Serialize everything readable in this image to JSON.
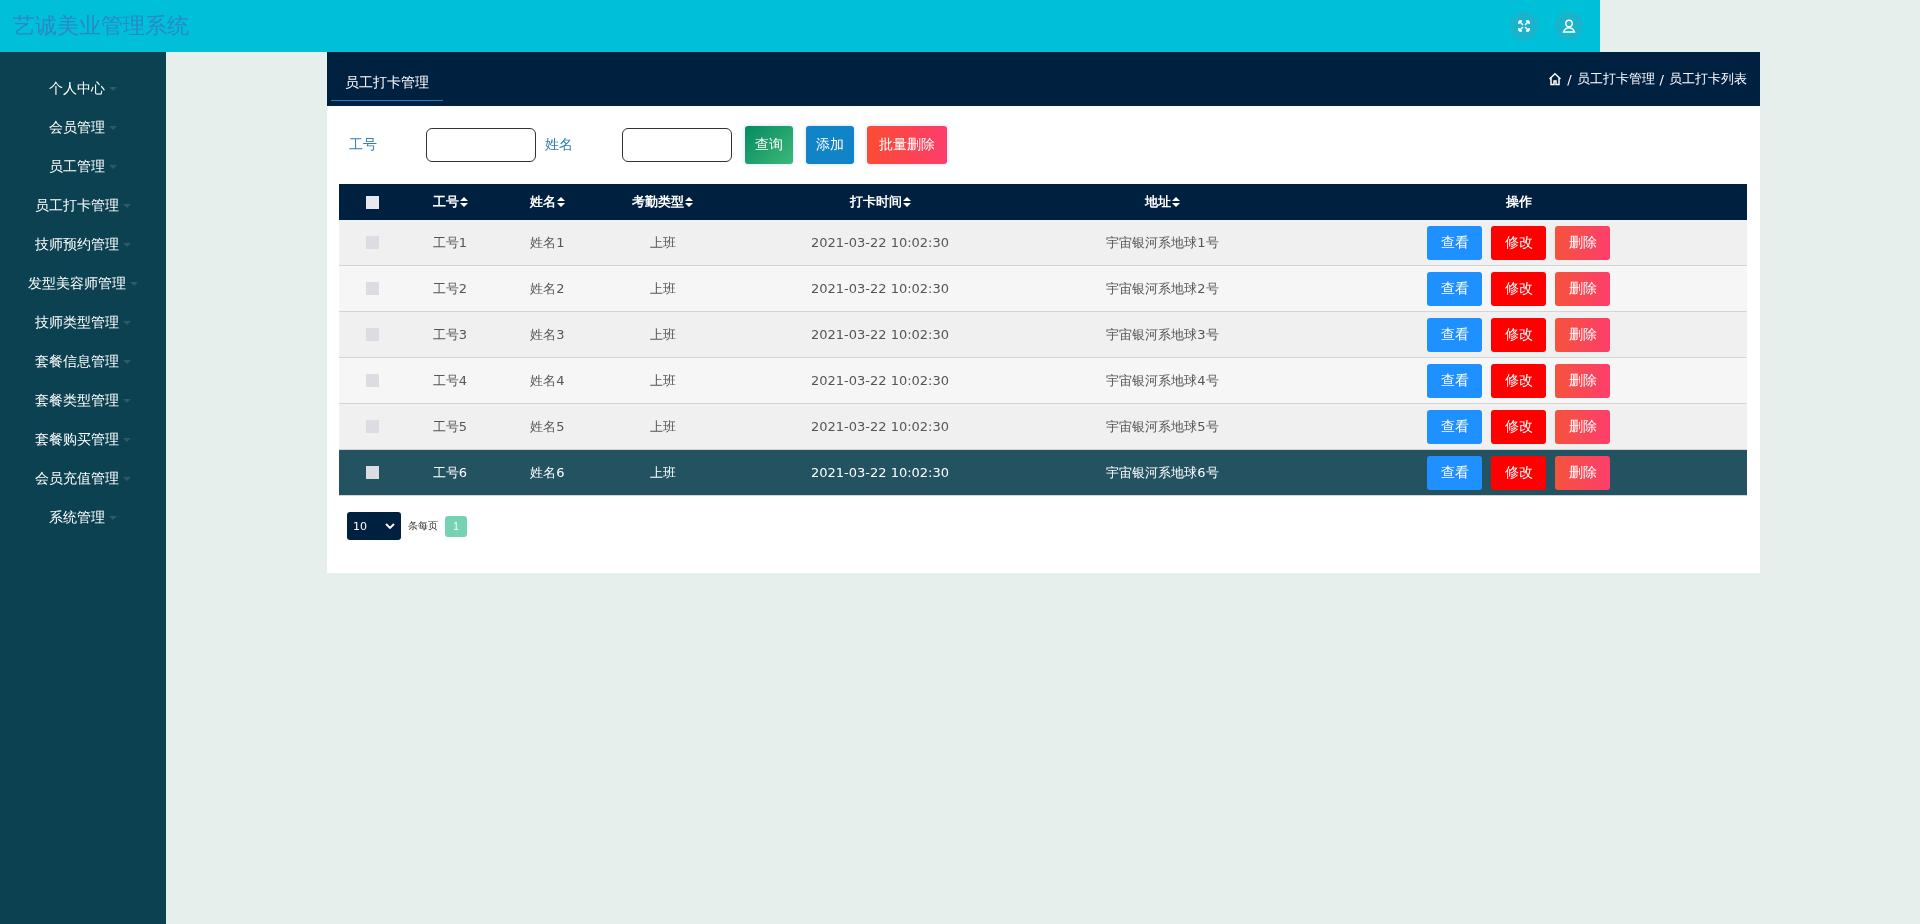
{
  "header": {
    "title": "艺诚美业管理系统"
  },
  "sidebar": {
    "items": [
      {
        "label": "个人中心"
      },
      {
        "label": "会员管理"
      },
      {
        "label": "员工管理"
      },
      {
        "label": "员工打卡管理"
      },
      {
        "label": "技师预约管理"
      },
      {
        "label": "发型美容师管理"
      },
      {
        "label": "技师类型管理"
      },
      {
        "label": "套餐信息管理"
      },
      {
        "label": "套餐类型管理"
      },
      {
        "label": "套餐购买管理"
      },
      {
        "label": "会员充值管理"
      },
      {
        "label": "系统管理"
      }
    ]
  },
  "page": {
    "tab": "员工打卡管理",
    "breadcrumb": [
      {
        "separator": "/",
        "label": "员工打卡管理"
      },
      {
        "separator": "/",
        "label": "员工打卡列表"
      }
    ]
  },
  "search": {
    "fields": [
      {
        "label": "工号"
      },
      {
        "label": "姓名"
      }
    ],
    "buttons": [
      {
        "label": "查询",
        "kind": "query"
      },
      {
        "label": "添加",
        "kind": "add"
      },
      {
        "label": "批量删除",
        "kind": "delete"
      }
    ]
  },
  "table": {
    "select_all": {
      "checked": false
    },
    "columns": [
      {
        "label": "工号",
        "sortable": true
      },
      {
        "label": "姓名",
        "sortable": true
      },
      {
        "label": "考勤类型",
        "sortable": true
      },
      {
        "label": "打卡时间",
        "sortable": true
      },
      {
        "label": "地址",
        "sortable": true
      },
      {
        "label": "操作",
        "sortable": false
      }
    ],
    "rows": [
      {
        "checked": false,
        "cells": [
          "工号1",
          "姓名1",
          "上班",
          "2021-03-22 10:02:30",
          "宇宙银河系地球1号"
        ],
        "actions": [
          "查看",
          "修改",
          "删除"
        ],
        "selected": false
      },
      {
        "checked": false,
        "cells": [
          "工号2",
          "姓名2",
          "上班",
          "2021-03-22 10:02:30",
          "宇宙银河系地球2号"
        ],
        "actions": [
          "查看",
          "修改",
          "删除"
        ],
        "selected": false
      },
      {
        "checked": false,
        "cells": [
          "工号3",
          "姓名3",
          "上班",
          "2021-03-22 10:02:30",
          "宇宙银河系地球3号"
        ],
        "actions": [
          "查看",
          "修改",
          "删除"
        ],
        "selected": false
      },
      {
        "checked": false,
        "cells": [
          "工号4",
          "姓名4",
          "上班",
          "2021-03-22 10:02:30",
          "宇宙银河系地球4号"
        ],
        "actions": [
          "查看",
          "修改",
          "删除"
        ],
        "selected": false
      },
      {
        "checked": false,
        "cells": [
          "工号5",
          "姓名5",
          "上班",
          "2021-03-22 10:02:30",
          "宇宙银河系地球5号"
        ],
        "actions": [
          "查看",
          "修改",
          "删除"
        ],
        "selected": false
      },
      {
        "checked": false,
        "cells": [
          "工号6",
          "姓名6",
          "上班",
          "2021-03-22 10:02:30",
          "宇宙银河系地球6号"
        ],
        "actions": [
          "查看",
          "修改",
          "删除"
        ],
        "selected": true
      }
    ]
  },
  "pagination": {
    "page_size": "10",
    "page_size_label": "条每页",
    "pages": [
      {
        "label": "1",
        "selected": true
      }
    ]
  }
}
